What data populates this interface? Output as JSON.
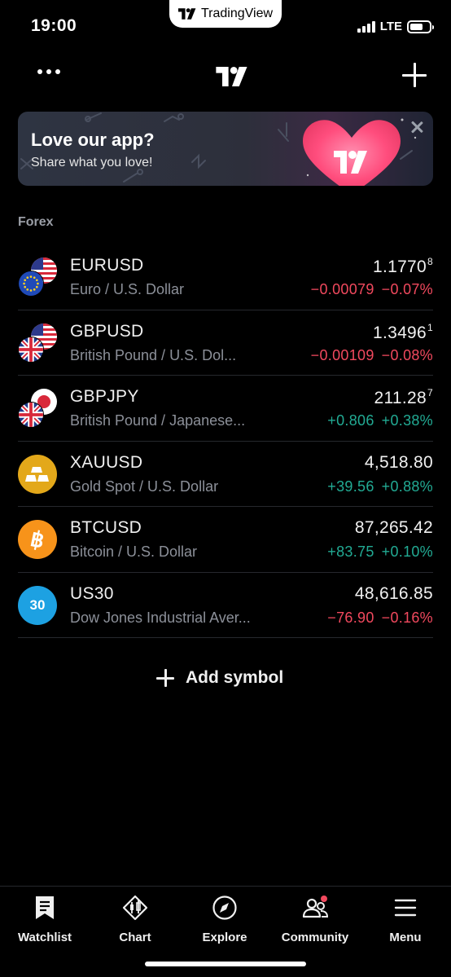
{
  "status_bar": {
    "time": "19:00",
    "app_pill": "TradingView",
    "network": "LTE"
  },
  "top_nav": {
    "menu_icon": "more-dots-icon",
    "logo": "tradingview-logo",
    "add_icon": "plus-icon"
  },
  "banner": {
    "title": "Love our app?",
    "subtitle": "Share what you love!"
  },
  "section": {
    "title": "Forex"
  },
  "colors": {
    "negative": "#f2495e",
    "positive": "#22ab94",
    "background": "#000000",
    "muted": "#8c9099"
  },
  "symbols": [
    {
      "ticker": "EURUSD",
      "description": "Euro / U.S. Dollar",
      "price_main": "1.1770",
      "price_sup": "8",
      "change": "−0.00079",
      "change_pct": "−0.07%",
      "direction": "negative",
      "icon": "eur-usd-flags-icon"
    },
    {
      "ticker": "GBPUSD",
      "description": "British Pound / U.S. Dol...",
      "price_main": "1.3496",
      "price_sup": "1",
      "change": "−0.00109",
      "change_pct": "−0.08%",
      "direction": "negative",
      "icon": "gbp-usd-flags-icon"
    },
    {
      "ticker": "GBPJPY",
      "description": "British Pound / Japanese...",
      "price_main": "211.28",
      "price_sup": "7",
      "change": "+0.806",
      "change_pct": "+0.38%",
      "direction": "positive",
      "icon": "gbp-jpy-flags-icon"
    },
    {
      "ticker": "XAUUSD",
      "description": "Gold Spot / U.S. Dollar",
      "price_main": "4,518.80",
      "price_sup": "",
      "change": "+39.56",
      "change_pct": "+0.88%",
      "direction": "positive",
      "icon": "gold-bars-icon"
    },
    {
      "ticker": "BTCUSD",
      "description": "Bitcoin / U.S. Dollar",
      "price_main": "87,265.42",
      "price_sup": "",
      "change": "+83.75",
      "change_pct": "+0.10%",
      "direction": "positive",
      "icon": "bitcoin-icon"
    },
    {
      "ticker": "US30",
      "description": "Dow Jones Industrial Aver...",
      "price_main": "48,616.85",
      "price_sup": "",
      "change": "−76.90",
      "change_pct": "−0.16%",
      "direction": "negative",
      "icon": "us30-index-icon",
      "icon_text": "30"
    }
  ],
  "add_symbol": {
    "label": "Add symbol"
  },
  "tabs": [
    {
      "label": "Watchlist",
      "icon": "bookmark-icon",
      "active": true
    },
    {
      "label": "Chart",
      "icon": "chart-candles-icon",
      "active": false
    },
    {
      "label": "Explore",
      "icon": "compass-icon",
      "active": false
    },
    {
      "label": "Community",
      "icon": "community-icon",
      "active": false,
      "badge": true
    },
    {
      "label": "Menu",
      "icon": "hamburger-menu-icon",
      "active": false
    }
  ]
}
